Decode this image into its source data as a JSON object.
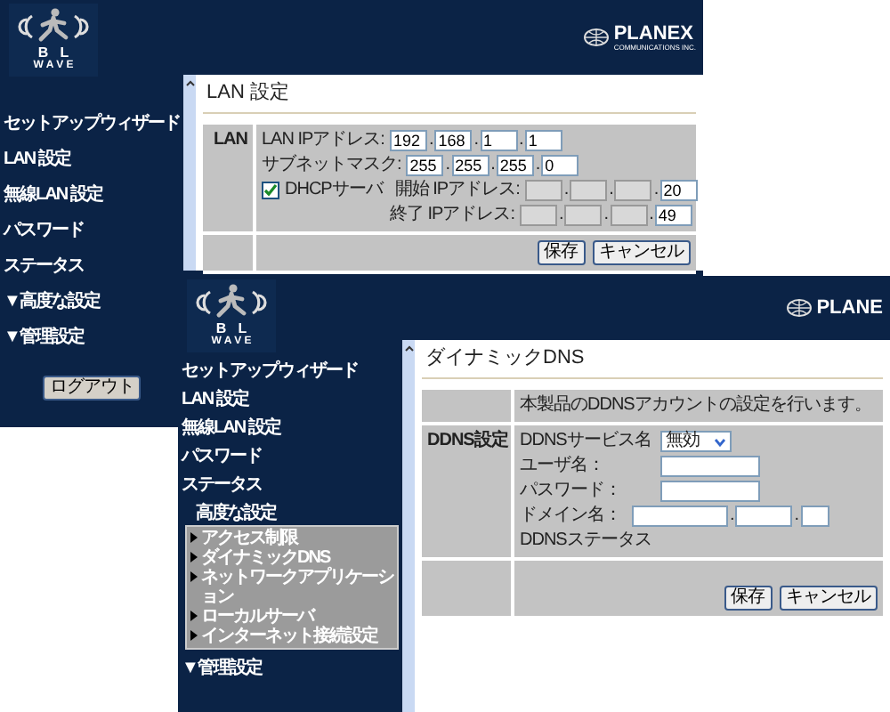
{
  "windows": [
    {
      "logo": {
        "letters_top": "B   L",
        "letters_bottom": "W A V E"
      },
      "brand": {
        "name": "PLANEX",
        "tagline": "COMMUNICATIONS INC."
      },
      "sidebar": {
        "items": [
          {
            "kind": "link",
            "label": "セットアップウィザード"
          },
          {
            "kind": "link",
            "label": "LAN 設定"
          },
          {
            "kind": "link",
            "label": "無線LAN 設定"
          },
          {
            "kind": "link",
            "label": "パスワード"
          },
          {
            "kind": "link",
            "label": "ステータス"
          },
          {
            "kind": "link",
            "label": "▼高度な設定"
          },
          {
            "kind": "link",
            "label": "▼管理設定"
          }
        ],
        "logout_button": "ログアウト"
      },
      "panel": {
        "title": "LAN 設定",
        "rows": [
          {
            "label": "LAN",
            "fields": [
              {
                "kind": "ip",
                "label": "LAN IPアドレス:",
                "separator": ".",
                "octets": [
                  {
                    "value": "192",
                    "disabled": false
                  },
                  {
                    "value": "168",
                    "disabled": false
                  },
                  {
                    "value": "1",
                    "disabled": false
                  },
                  {
                    "value": "1",
                    "disabled": false
                  }
                ]
              },
              {
                "kind": "ip",
                "label": "サブネットマスク:",
                "separator": ".",
                "octets": [
                  {
                    "value": "255",
                    "disabled": false
                  },
                  {
                    "value": "255",
                    "disabled": false
                  },
                  {
                    "value": "255",
                    "disabled": false
                  },
                  {
                    "value": "0",
                    "disabled": false
                  }
                ]
              },
              {
                "kind": "check-ip",
                "check_label": "DHCPサーバ",
                "checked": true,
                "label": "開始 IPアドレス:",
                "separator": ".",
                "octets": [
                  {
                    "disabled": true
                  },
                  {
                    "disabled": true
                  },
                  {
                    "disabled": true
                  },
                  {
                    "value": "20",
                    "disabled": false
                  }
                ]
              },
              {
                "kind": "sub-ip",
                "label": "終了 IPアドレス:",
                "separator": ".",
                "octets": [
                  {
                    "disabled": true
                  },
                  {
                    "disabled": true
                  },
                  {
                    "disabled": true
                  },
                  {
                    "value": "49",
                    "disabled": false
                  }
                ]
              }
            ]
          }
        ],
        "buttons": [
          "保存",
          "キャンセル"
        ]
      }
    },
    {
      "logo": {
        "letters_top": "B   L",
        "letters_bottom": "W A V E"
      },
      "brand": {
        "name": "PLANE"
      },
      "sidebar": {
        "items": [
          {
            "kind": "link",
            "label": "セットアップウィザード"
          },
          {
            "kind": "link",
            "label": "LAN 設定"
          },
          {
            "kind": "link",
            "label": "無線LAN 設定"
          },
          {
            "kind": "link",
            "label": "パスワード"
          },
          {
            "kind": "link",
            "label": "ステータス"
          },
          {
            "kind": "group",
            "label": "高度な設定",
            "children": [
              {
                "label": "アクセス制限"
              },
              {
                "label": "ダイナミックDNS"
              },
              {
                "label": "ネットワークアプリケーション"
              },
              {
                "label": "ローカルサーバ"
              },
              {
                "label": "インターネット接続設定"
              }
            ]
          },
          {
            "kind": "link",
            "label": "▼管理設定"
          }
        ]
      },
      "panel": {
        "title": "ダイナミックDNS",
        "rows": [
          {
            "fields": [
              {
                "kind": "text",
                "text": "本製品のDDNSアカウントの設定を行います。"
              }
            ]
          },
          {
            "label": "DDNS設定",
            "fields": [
              {
                "kind": "select",
                "label": "DDNSサービス名",
                "value": "無効"
              },
              {
                "kind": "input",
                "label": "ユーザ名："
              },
              {
                "kind": "input",
                "label": "パスワード："
              },
              {
                "kind": "domain",
                "label": "ドメイン名：",
                "separator": "."
              },
              {
                "kind": "text",
                "text": "DDNSステータス"
              }
            ]
          }
        ],
        "buttons": [
          "保存",
          "キャンセル"
        ]
      }
    }
  ]
}
